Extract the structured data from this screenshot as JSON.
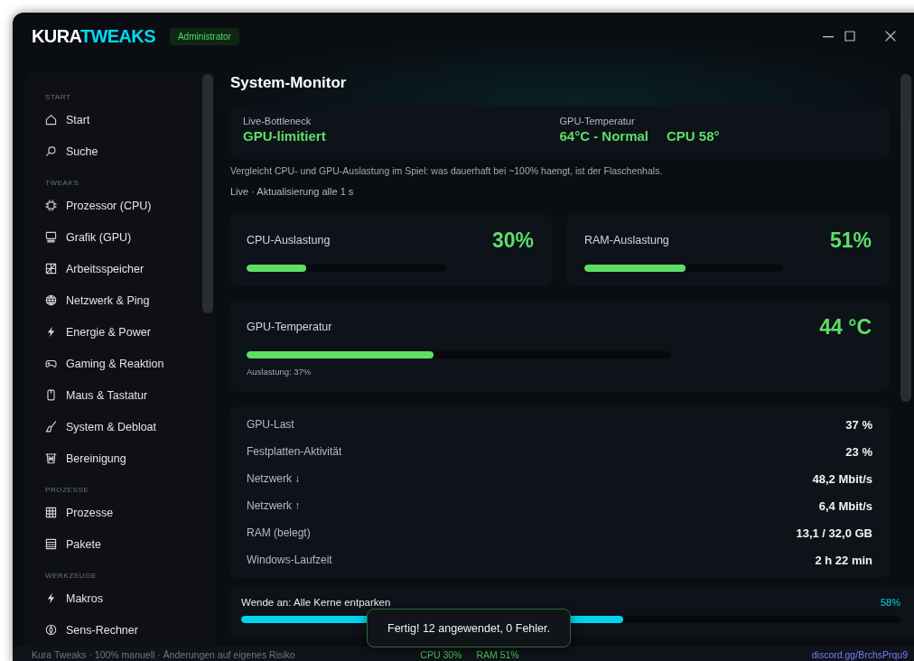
{
  "window": {
    "logo": [
      "KURA",
      "TWEAKS"
    ],
    "badge": "Administrator"
  },
  "sidebar": {
    "sections": [
      {
        "heading": "START",
        "items": [
          {
            "label": "Start",
            "selected": false
          },
          {
            "label": "Suche",
            "selected": false
          }
        ]
      },
      {
        "heading": "TWEAKS",
        "items": [
          {
            "label": "Prozessor (CPU)",
            "selected": false
          },
          {
            "label": "Grafik (GPU)",
            "selected": false
          },
          {
            "label": "Arbeitsspeicher",
            "selected": false
          },
          {
            "label": "Netzwerk & Ping",
            "selected": false
          },
          {
            "label": "Energie & Power",
            "selected": false
          },
          {
            "label": "Gaming & Reaktion",
            "selected": false
          },
          {
            "label": "Maus & Tastatur",
            "selected": false
          },
          {
            "label": "System & Debloat",
            "selected": false
          },
          {
            "label": "Bereinigung",
            "selected": false
          }
        ]
      },
      {
        "heading": "PROZESSE",
        "items": [
          {
            "label": "Prozesse",
            "selected": false
          },
          {
            "label": "Pakete",
            "selected": false
          }
        ]
      },
      {
        "heading": "WERKZEUGE",
        "items": [
          {
            "label": "Makros",
            "selected": false
          },
          {
            "label": "Sens-Rechner",
            "selected": false
          }
        ]
      }
    ]
  },
  "page": {
    "title": "System-Monitor",
    "bottleneck": {
      "fields": [
        {
          "label": "Live-Bottleneck",
          "values": [
            "GPU-limitiert"
          ]
        },
        {
          "label": "GPU-Temperatur",
          "values": [
            "64°C - Normal",
            "CPU 58°"
          ]
        }
      ]
    },
    "description": "Vergleicht CPU- und GPU-Auslastung im Spiel: was dauerhaft bei ~100% haengt, ist der Flaschenhals.",
    "live_note": "Live · Aktualisierung alle 1 s",
    "meters": [
      {
        "label": "CPU-Auslastung",
        "reading": "30%",
        "level": 0.3
      },
      {
        "label": "RAM-Auslastung",
        "reading": "51%",
        "level": 0.51
      }
    ],
    "gpu_temperature": {
      "label": "GPU-Temperatur",
      "reading": "44 °C",
      "level": 0.44,
      "note": "Auslastung: 37%"
    },
    "stats": [
      {
        "label": "GPU-Last",
        "value": "37 %"
      },
      {
        "label": "Festplatten-Aktivität",
        "value": "23 %"
      },
      {
        "label": "Netzwerk ↓",
        "value": "48,2 Mbit/s"
      },
      {
        "label": "Netzwerk ↑",
        "value": "6,4 Mbit/s"
      },
      {
        "label": "RAM (belegt)",
        "value": "13,1 / 32,0 GB"
      },
      {
        "label": "Windows-Laufzeit",
        "value": "2 h 22 min"
      }
    ]
  },
  "task": {
    "label": "Wende an: Alle Kerne entparken",
    "reading": "58%",
    "level": 0.58
  },
  "toast": "Fertig! 12 angewendet, 0 Fehler.",
  "status_bar": {
    "text": "Kura Tweaks · 100% manuell · Änderungen auf eigenes Risiko",
    "cpu": "CPU 30%",
    "ram": "RAM 51%",
    "link": "discord.gg/BrchsPrqu9"
  }
}
